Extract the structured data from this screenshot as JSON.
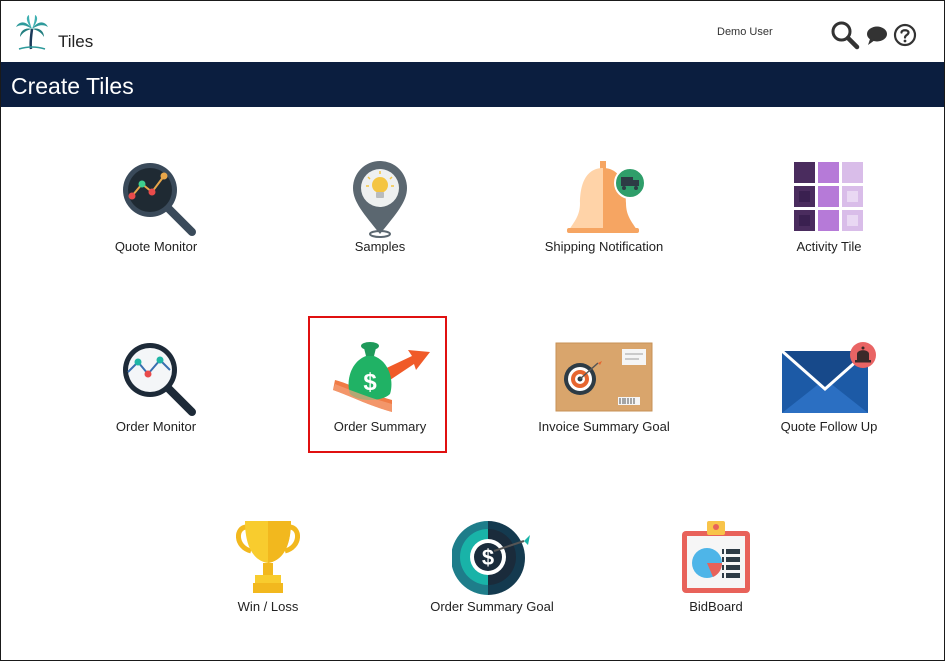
{
  "header": {
    "app_title": "Tiles",
    "user_name": "Demo User",
    "icons": [
      "palm-tree-logo",
      "search-icon",
      "chat-icon",
      "help-icon"
    ]
  },
  "banner": {
    "title": "Create Tiles",
    "background": "#0b1e3f"
  },
  "tiles": [
    {
      "label": "Quote Monitor",
      "icon": "magnifier-chart-icon"
    },
    {
      "label": "Samples",
      "icon": "map-pin-bulb-icon"
    },
    {
      "label": "Shipping Notification",
      "icon": "bell-truck-icon"
    },
    {
      "label": "Activity Tile",
      "icon": "grid-squares-icon"
    },
    {
      "label": "Order Monitor",
      "icon": "magnifier-chart-icon"
    },
    {
      "label": "Order Summary",
      "icon": "money-bag-arrow-icon",
      "selected": true
    },
    {
      "label": "Invoice Summary Goal",
      "icon": "envelope-target-icon"
    },
    {
      "label": "Quote Follow Up",
      "icon": "envelope-bell-icon"
    },
    {
      "label": "Win / Loss",
      "icon": "trophy-icon"
    },
    {
      "label": "Order Summary Goal",
      "icon": "dollar-target-icon"
    },
    {
      "label": "BidBoard",
      "icon": "clipboard-chart-icon"
    }
  ],
  "colors": {
    "selected_outline": "#e01010"
  }
}
